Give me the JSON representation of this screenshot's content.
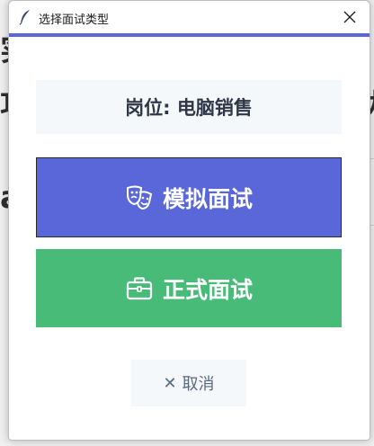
{
  "window": {
    "title": "选择面试类型",
    "accent_color": "#5a67d8"
  },
  "background_app": {
    "glyphs": [
      "实",
      "功",
      "a",
      "力"
    ]
  },
  "dialog": {
    "position_label": "岗位: 电脑销售",
    "mock_interview": {
      "label": "模拟面试",
      "icon": "theater-masks-icon",
      "color": "#5a67d8"
    },
    "formal_interview": {
      "label": "正式面试",
      "icon": "briefcase-icon",
      "color": "#48bb78"
    },
    "cancel": {
      "label": "取消",
      "icon": "close-icon"
    }
  }
}
